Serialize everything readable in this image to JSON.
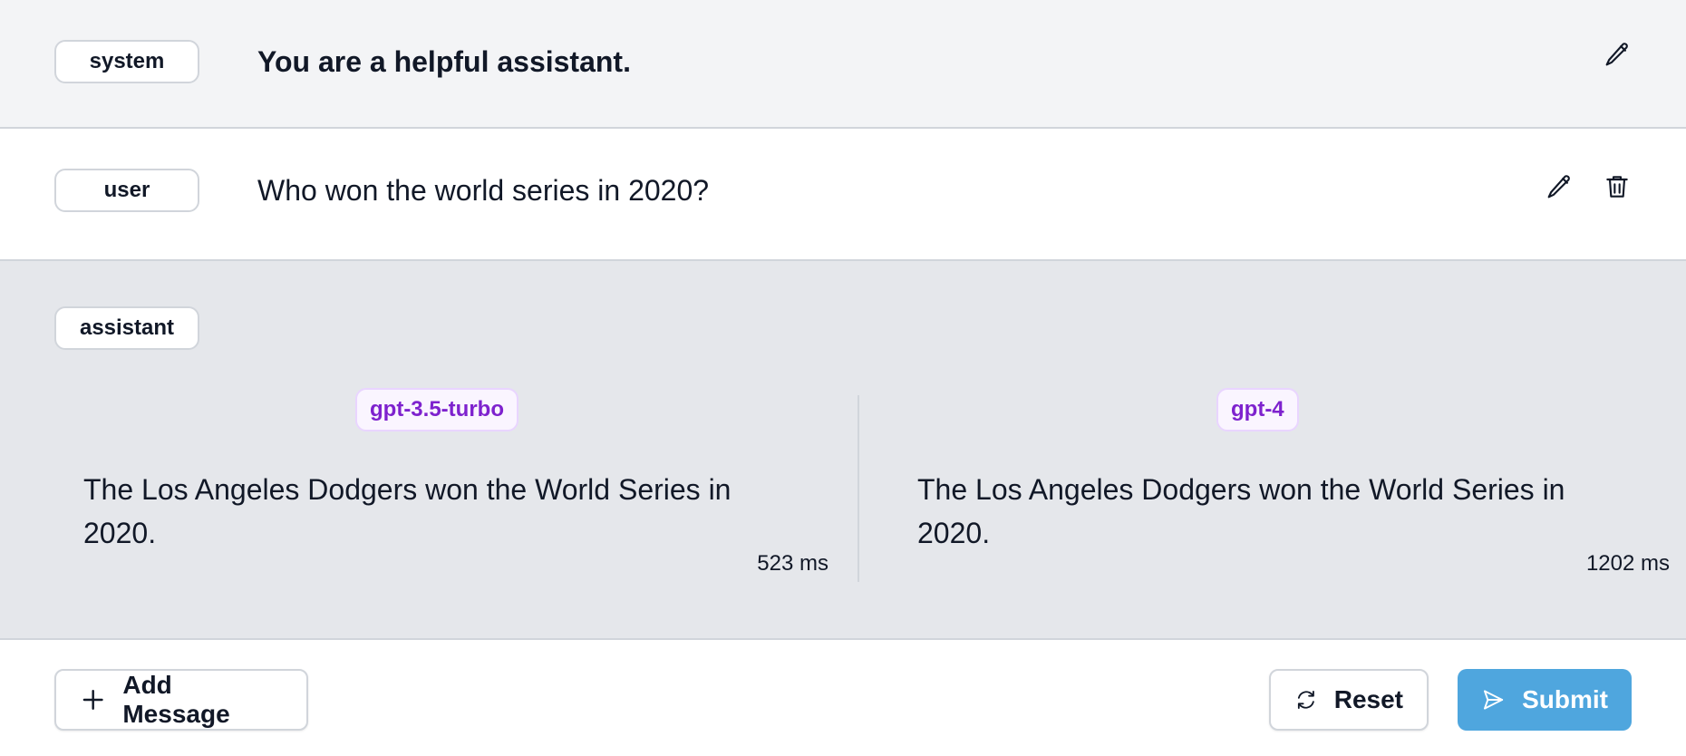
{
  "messages": {
    "system": {
      "role": "system",
      "text": "You are a helpful assistant."
    },
    "user": {
      "role": "user",
      "text": "Who won the world series in 2020?"
    },
    "assistant": {
      "role": "assistant",
      "responses": [
        {
          "model": "gpt-3.5-turbo",
          "text": "The Los Angeles Dodgers won the World Series in 2020.",
          "latency": "523 ms"
        },
        {
          "model": "gpt-4",
          "text": "The Los Angeles Dodgers won the World Series in 2020.",
          "latency": "1202 ms"
        }
      ]
    }
  },
  "icons": {
    "edit": "pencil-icon",
    "delete": "trash-icon",
    "add": "plus-icon",
    "reset": "refresh-icon",
    "submit": "send-icon"
  },
  "footer": {
    "add_label": "Add Message",
    "reset_label": "Reset",
    "submit_label": "Submit"
  },
  "colors": {
    "system_bg": "#f3f4f6",
    "assistant_bg": "#e5e7eb",
    "model_badge_text": "#7e22ce",
    "model_badge_bg": "#faf5ff",
    "submit_bg": "#4fa6de"
  }
}
